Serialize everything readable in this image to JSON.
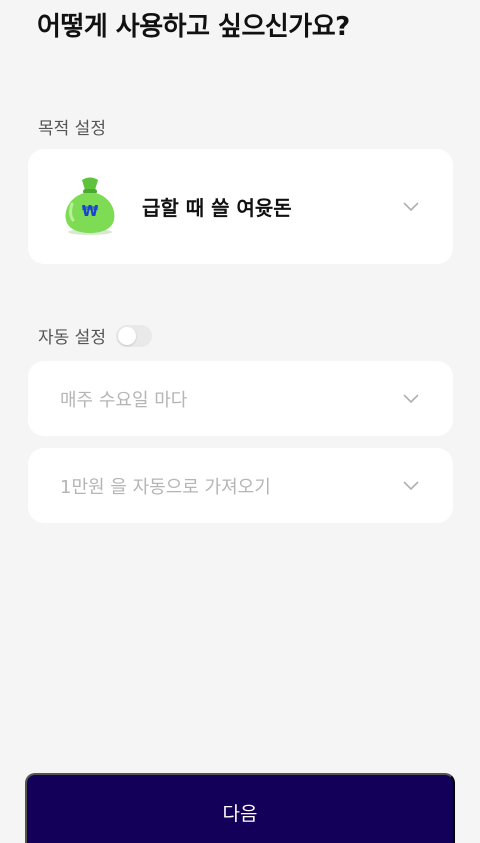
{
  "header": {
    "title": "어떻게 사용하고 싶으신가요?"
  },
  "purpose": {
    "label": "목적 설정",
    "selected": "급할 때 쓸 여윳돈",
    "icon": "money-bag-icon"
  },
  "auto": {
    "label": "자동 설정",
    "enabled": false,
    "day_placeholder": "매주 수요일 마다",
    "amount_placeholder": "1만원 을 자동으로 가져오기"
  },
  "footer": {
    "next_label": "다음"
  },
  "colors": {
    "background": "#f5f5f5",
    "card": "#ffffff",
    "button": "#130058",
    "bag": "#6fd44a",
    "won_symbol": "#1b3fd8"
  }
}
